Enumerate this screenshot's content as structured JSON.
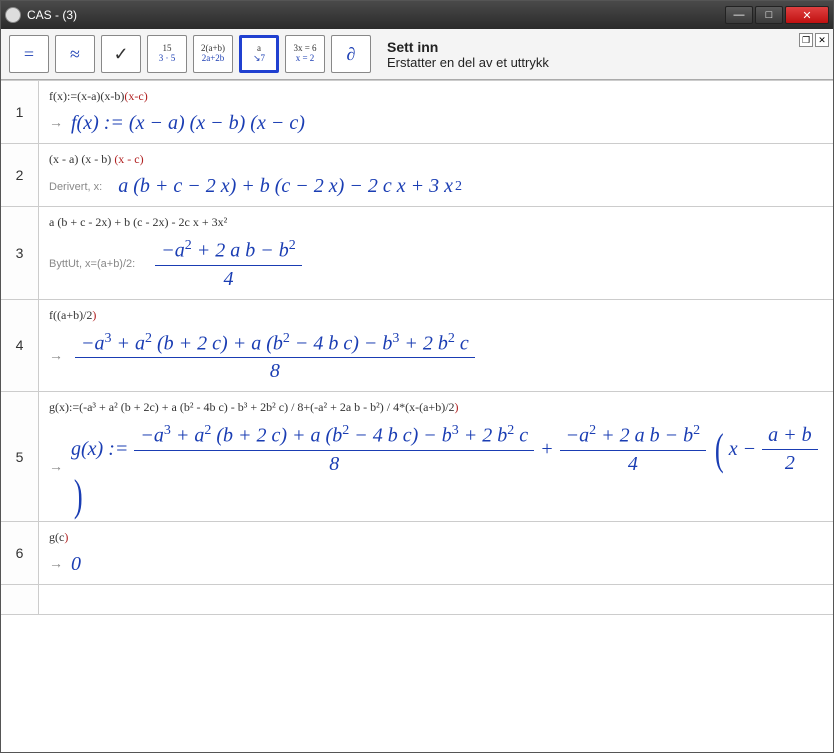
{
  "window": {
    "title": "CAS - (3)"
  },
  "toolbar": {
    "eq": "=",
    "approx": "≈",
    "check": "✓",
    "eval_top": "15",
    "eval_bot": "3 · 5",
    "factor_top": "2(a+b)",
    "factor_bot": "2a+2b",
    "subst_top": "a",
    "subst_bot": "↘7",
    "solve_top": "3x = 6",
    "solve_bot": "x = 2",
    "deriv": "∂"
  },
  "tooltip": {
    "title": "Sett inn",
    "desc": "Erstatter en del av et uttrykk"
  },
  "rows": [
    {
      "n": "1",
      "input_plain": "f(x):=(x-a)(x-b)",
      "input_last": "(x-c)",
      "prefix": "",
      "output": "f(x) := (x − a) (x − b) (x − c)"
    },
    {
      "n": "2",
      "input_plain": "(x - a) (x - b) ",
      "input_last": "(x - c)",
      "prefix": "Derivert, x:",
      "output_html": "a&nbsp;(b + c − 2 x) + b&nbsp;(c − 2 x) − 2 c x + 3 x<sup>2</sup>"
    },
    {
      "n": "3",
      "input_plain": "a (b + c - 2x) + b (c - 2x) - 2c x + 3x²",
      "input_last": "",
      "prefix": "ByttUt, x=(a+b)/2:",
      "frac_num": "−a<sup>2</sup> + 2 a b − b<sup>2</sup>",
      "frac_den": "4"
    },
    {
      "n": "4",
      "input_plain": "f((a+b)/2",
      "input_last": ")",
      "prefix": "",
      "frac_num": "−a<sup>3</sup> + a<sup>2</sup>&nbsp;(b + 2 c) + a&nbsp;(b<sup>2</sup> − 4 b c) − b<sup>3</sup> + 2 b<sup>2</sup> c",
      "frac_den": "8"
    },
    {
      "n": "5",
      "input_plain": "g(x):=(-a³ + a² (b + 2c) + a (b² - 4b c) - b³ + 2b² c) / 8+(-a² + 2a b - b²) / 4*(x-(a+b)/2",
      "input_last": ")",
      "prefix": "",
      "g_lead": "g(x) := ",
      "g_f1_num": "−a<sup>3</sup> + a<sup>2</sup>&nbsp;(b + 2 c) + a&nbsp;(b<sup>2</sup> − 4 b c) − b<sup>3</sup> + 2 b<sup>2</sup> c",
      "g_f1_den": "8",
      "g_plus": " + ",
      "g_f2_num": "−a<sup>2</sup> + 2 a b − b<sup>2</sup>",
      "g_f2_den": "4",
      "g_tail_x": "x − ",
      "g_tail_num": "a + b",
      "g_tail_den": "2"
    },
    {
      "n": "6",
      "input_plain": "g(c",
      "input_last": ")",
      "prefix": "",
      "output": "0"
    }
  ]
}
